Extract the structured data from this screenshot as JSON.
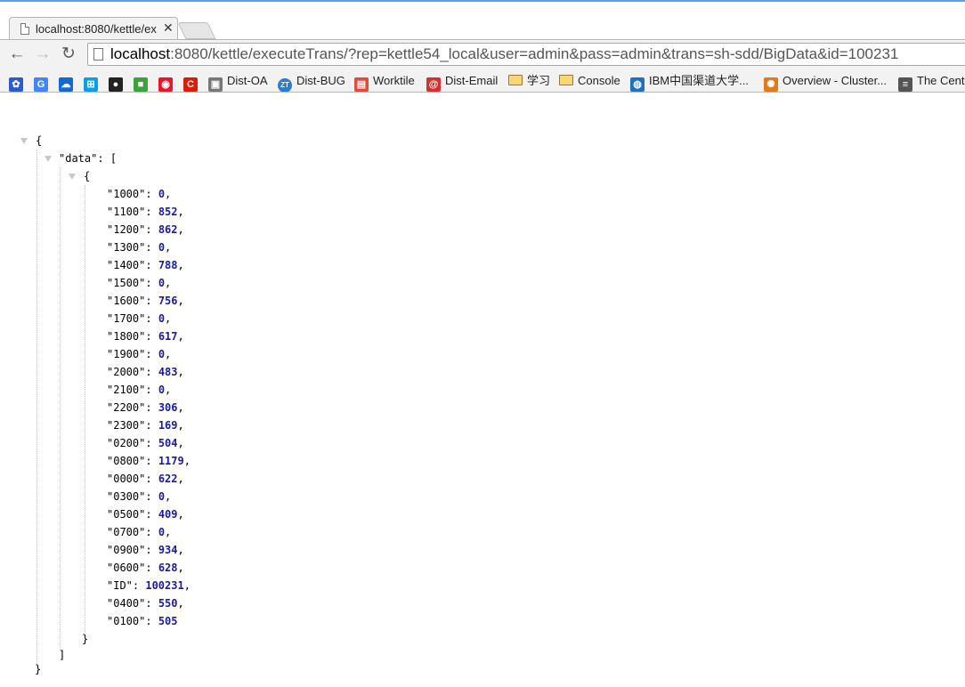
{
  "browser": {
    "tab_title": "localhost:8080/kettle/ex",
    "url_host": "localhost",
    "url_rest": ":8080/kettle/executeTrans/?rep=kettle54_local&user=admin&pass=admin&trans=sh-sdd/BigData&id=100231",
    "bookmarks": [
      {
        "label": "",
        "icon": "baidu-icon",
        "color": "#2b5ccf"
      },
      {
        "label": "",
        "icon": "google-icon",
        "color": "#4285f4"
      },
      {
        "label": "",
        "icon": "onedrive-icon",
        "color": "#0f6ad6"
      },
      {
        "label": "",
        "icon": "windows-icon",
        "color": "#0aa0e8"
      },
      {
        "label": "",
        "icon": "github-icon",
        "color": "#222222"
      },
      {
        "label": "",
        "icon": "green-app-icon",
        "color": "#3aa33a"
      },
      {
        "label": "",
        "icon": "weibo-icon",
        "color": "#e6162d"
      },
      {
        "label": "",
        "icon": "red-c-icon",
        "color": "#d81e06"
      },
      {
        "label": "Dist-OA",
        "icon": "dist-oa-icon",
        "color": "#777777"
      },
      {
        "label": "Dist-BUG",
        "icon": "zentao-icon",
        "color": "#2e7bcf"
      },
      {
        "label": "Worktile",
        "icon": "worktile-icon",
        "color": "#e04a3a"
      },
      {
        "label": "Dist-Email",
        "icon": "email-icon",
        "color": "#d9302c"
      },
      {
        "label": "学习",
        "icon": "folder-icon",
        "color": "#f5d77a"
      },
      {
        "label": "Console",
        "icon": "folder-icon",
        "color": "#f5d77a"
      },
      {
        "label": "IBM中国渠道大学...",
        "icon": "ibm-icon",
        "color": "#1f70c1"
      },
      {
        "label": "Overview - Cluster...",
        "icon": "cluster-icon",
        "color": "#e07a1a"
      },
      {
        "label": "The Centr",
        "icon": "list-icon",
        "color": "#555555"
      }
    ]
  },
  "json": {
    "open_brace": "{",
    "data_key": "\"data\"",
    "open_bracket": "[",
    "inner_open": "{",
    "inner_close": "}",
    "close_bracket": "]",
    "close_brace": "}",
    "entries": [
      {
        "key": "\"1000\"",
        "value": "0",
        "comma": ","
      },
      {
        "key": "\"1100\"",
        "value": "852",
        "comma": ","
      },
      {
        "key": "\"1200\"",
        "value": "862",
        "comma": ","
      },
      {
        "key": "\"1300\"",
        "value": "0",
        "comma": ","
      },
      {
        "key": "\"1400\"",
        "value": "788",
        "comma": ","
      },
      {
        "key": "\"1500\"",
        "value": "0",
        "comma": ","
      },
      {
        "key": "\"1600\"",
        "value": "756",
        "comma": ","
      },
      {
        "key": "\"1700\"",
        "value": "0",
        "comma": ","
      },
      {
        "key": "\"1800\"",
        "value": "617",
        "comma": ","
      },
      {
        "key": "\"1900\"",
        "value": "0",
        "comma": ","
      },
      {
        "key": "\"2000\"",
        "value": "483",
        "comma": ","
      },
      {
        "key": "\"2100\"",
        "value": "0",
        "comma": ","
      },
      {
        "key": "\"2200\"",
        "value": "306",
        "comma": ","
      },
      {
        "key": "\"2300\"",
        "value": "169",
        "comma": ","
      },
      {
        "key": "\"0200\"",
        "value": "504",
        "comma": ","
      },
      {
        "key": "\"0800\"",
        "value": "1179",
        "comma": ","
      },
      {
        "key": "\"0000\"",
        "value": "622",
        "comma": ","
      },
      {
        "key": "\"0300\"",
        "value": "0",
        "comma": ","
      },
      {
        "key": "\"0500\"",
        "value": "409",
        "comma": ","
      },
      {
        "key": "\"0700\"",
        "value": "0",
        "comma": ","
      },
      {
        "key": "\"0900\"",
        "value": "934",
        "comma": ","
      },
      {
        "key": "\"0600\"",
        "value": "628",
        "comma": ","
      },
      {
        "key": "\"ID\"",
        "value": "100231",
        "comma": ","
      },
      {
        "key": "\"0400\"",
        "value": "550",
        "comma": ","
      },
      {
        "key": "\"0100\"",
        "value": "505",
        "comma": ""
      }
    ]
  }
}
